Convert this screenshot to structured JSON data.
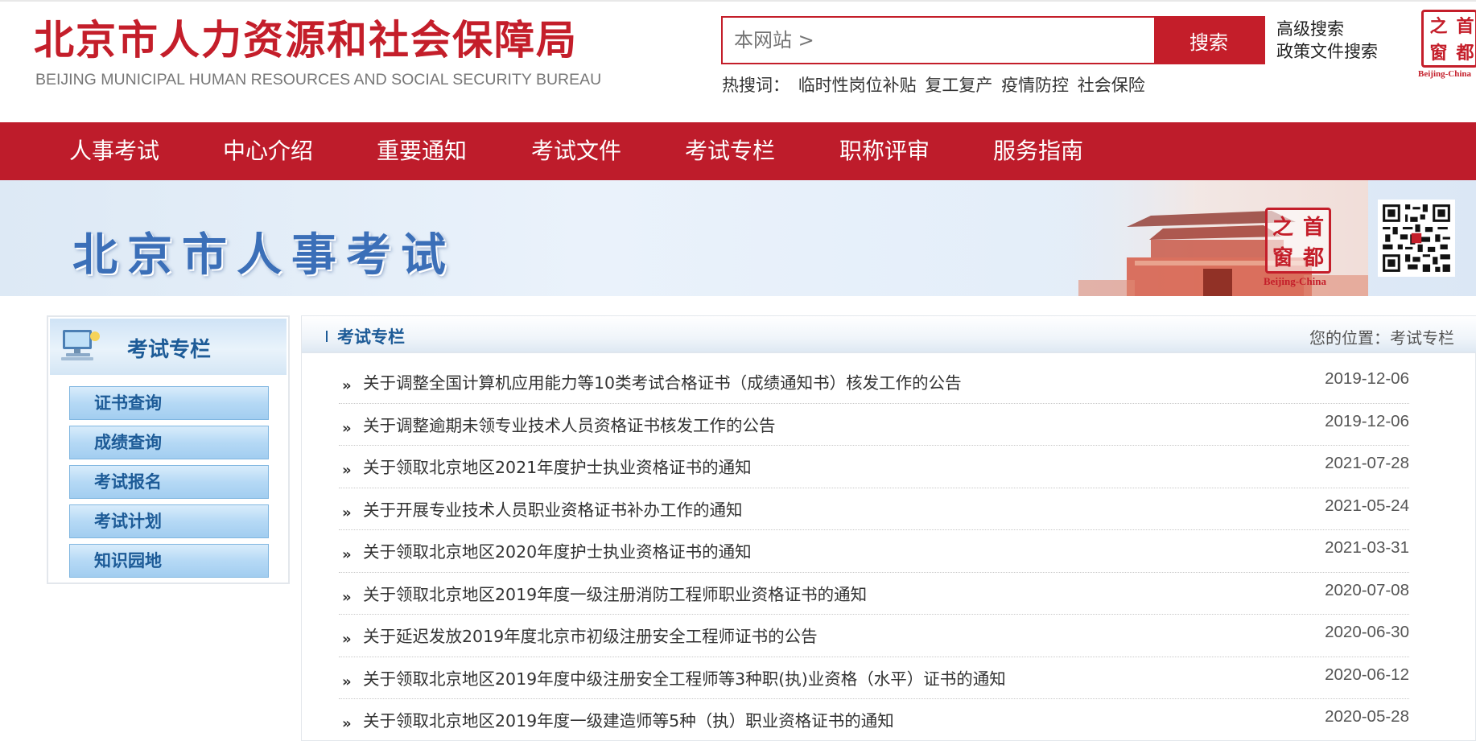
{
  "header": {
    "org_name_cn": "北京市人力资源和社会保障局",
    "org_name_en": "BEIJING MUNICIPAL HUMAN RESOURCES AND SOCIAL SECURITY BUREAU",
    "search": {
      "placeholder": "本网站 >",
      "button_label": "搜索"
    },
    "links": [
      "高级搜索",
      "政策文件搜索"
    ],
    "hot_label": "热搜词：",
    "hot_words": [
      "临时性岗位补贴",
      "复工复产",
      "疫情防控",
      "社会保险"
    ],
    "stamp": {
      "chars": [
        "之",
        "首",
        "窗",
        "都"
      ],
      "caption": "Beijing-China"
    }
  },
  "nav": [
    "人事考试",
    "中心介绍",
    "重要通知",
    "考试文件",
    "考试专栏",
    "职称评审",
    "服务指南"
  ],
  "banner": {
    "title": "北京市人事考试",
    "stamp": {
      "chars": [
        "之",
        "首",
        "窗",
        "都"
      ],
      "caption": "Beijing-China"
    }
  },
  "sidebar": {
    "title": "考试专栏",
    "items": [
      "证书查询",
      "成绩查询",
      "考试报名",
      "考试计划",
      "知识园地"
    ]
  },
  "main": {
    "section_title": "考试专栏",
    "breadcrumb": "您的位置：考试专栏",
    "articles": [
      {
        "title": "关于调整全国计算机应用能力等10类考试合格证书（成绩通知书）核发工作的公告",
        "date": "2019-12-06"
      },
      {
        "title": "关于调整逾期未领专业技术人员资格证书核发工作的公告",
        "date": "2019-12-06"
      },
      {
        "title": "关于领取北京地区2021年度护士执业资格证书的通知",
        "date": "2021-07-28"
      },
      {
        "title": "关于开展专业技术人员职业资格证书补办工作的通知",
        "date": "2021-05-24"
      },
      {
        "title": "关于领取北京地区2020年度护士执业资格证书的通知",
        "date": "2021-03-31"
      },
      {
        "title": "关于领取北京地区2019年度一级注册消防工程师职业资格证书的通知",
        "date": "2020-07-08"
      },
      {
        "title": "关于延迟发放2019年度北京市初级注册安全工程师证书的公告",
        "date": "2020-06-30"
      },
      {
        "title": "关于领取北京地区2019年度中级注册安全工程师等3种职(执)业资格（水平）证书的通知",
        "date": "2020-06-12"
      },
      {
        "title": "关于领取北京地区2019年度一级建造师等5种（执）职业资格证书的通知",
        "date": "2020-05-28"
      }
    ]
  },
  "colors": {
    "brand_red": "#be1c2b",
    "title_blue": "#1d5b97",
    "banner_blue": "#3b6fb8"
  }
}
